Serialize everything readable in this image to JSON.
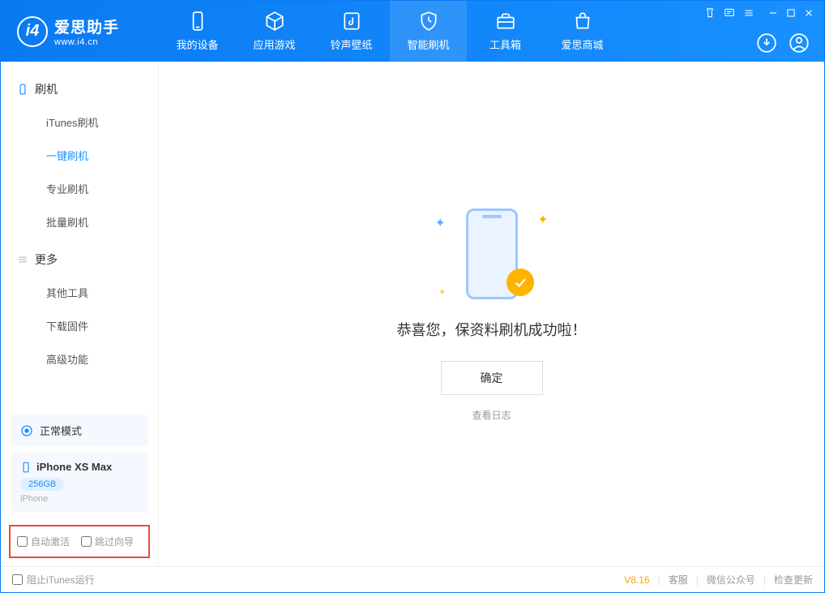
{
  "app": {
    "name_cn": "爱思助手",
    "name_en": "www.i4.cn"
  },
  "nav": {
    "items": [
      {
        "label": "我的设备"
      },
      {
        "label": "应用游戏"
      },
      {
        "label": "铃声壁纸"
      },
      {
        "label": "智能刷机"
      },
      {
        "label": "工具箱"
      },
      {
        "label": "爱思商城"
      }
    ]
  },
  "sidebar": {
    "section_flash": "刷机",
    "items_flash": [
      {
        "label": "iTunes刷机"
      },
      {
        "label": "一键刷机"
      },
      {
        "label": "专业刷机"
      },
      {
        "label": "批量刷机"
      }
    ],
    "section_more": "更多",
    "items_more": [
      {
        "label": "其他工具"
      },
      {
        "label": "下载固件"
      },
      {
        "label": "高级功能"
      }
    ]
  },
  "device": {
    "mode": "正常模式",
    "name": "iPhone XS Max",
    "capacity": "256GB",
    "type": "iPhone"
  },
  "options": {
    "auto_activate": "自动激活",
    "skip_guide": "跳过向导"
  },
  "main": {
    "success_msg": "恭喜您，保资料刷机成功啦！",
    "ok": "确定",
    "view_log": "查看日志"
  },
  "footer": {
    "block_itunes": "阻止iTunes运行",
    "version": "V8.16",
    "support": "客服",
    "wechat": "微信公众号",
    "update": "检查更新"
  }
}
